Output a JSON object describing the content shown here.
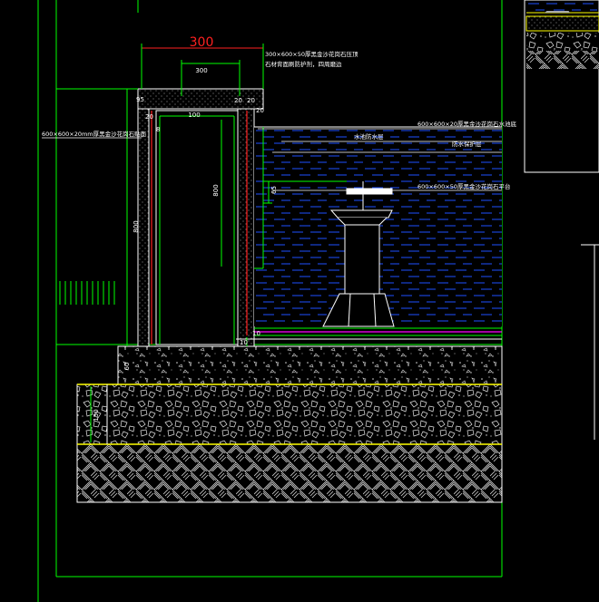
{
  "drawing": {
    "main_dimension": "300",
    "inner_dimension": "300",
    "dim_20_a": "20",
    "dim_20_b": "20",
    "dim_20_c": "20",
    "dim_20_d": "20",
    "dim_95": "95",
    "dim_100": "100",
    "dim_side_left": "800",
    "dim_side_right": "800",
    "dim_bottom_10": "10",
    "dim_60": "60",
    "dim_10_small": "10",
    "dim_150": "150",
    "dim_65": "65",
    "dim_8": "8",
    "note_top_1": "300×600×50厚黑金沙花岗石压顶",
    "note_top_2": "石材背面刷防护剂，四周磨边",
    "note_left": "600×600×20mm厚黑金沙花岗石贴面",
    "note_right_1": "600×600×20厚黑金沙花岗石水池底",
    "note_right_2": "水池防水层",
    "note_right_3": "防水保护层",
    "note_right_4": "600×600×50厚黑金沙花岗石平台"
  },
  "colors": {
    "background": "#000000",
    "green": "#00ff00",
    "white": "#ffffff",
    "red": "#ff2020",
    "blue": "#1e50ff",
    "yellow": "#ffff00",
    "magenta": "#ff00ff",
    "gray": "#c0c0c0"
  }
}
